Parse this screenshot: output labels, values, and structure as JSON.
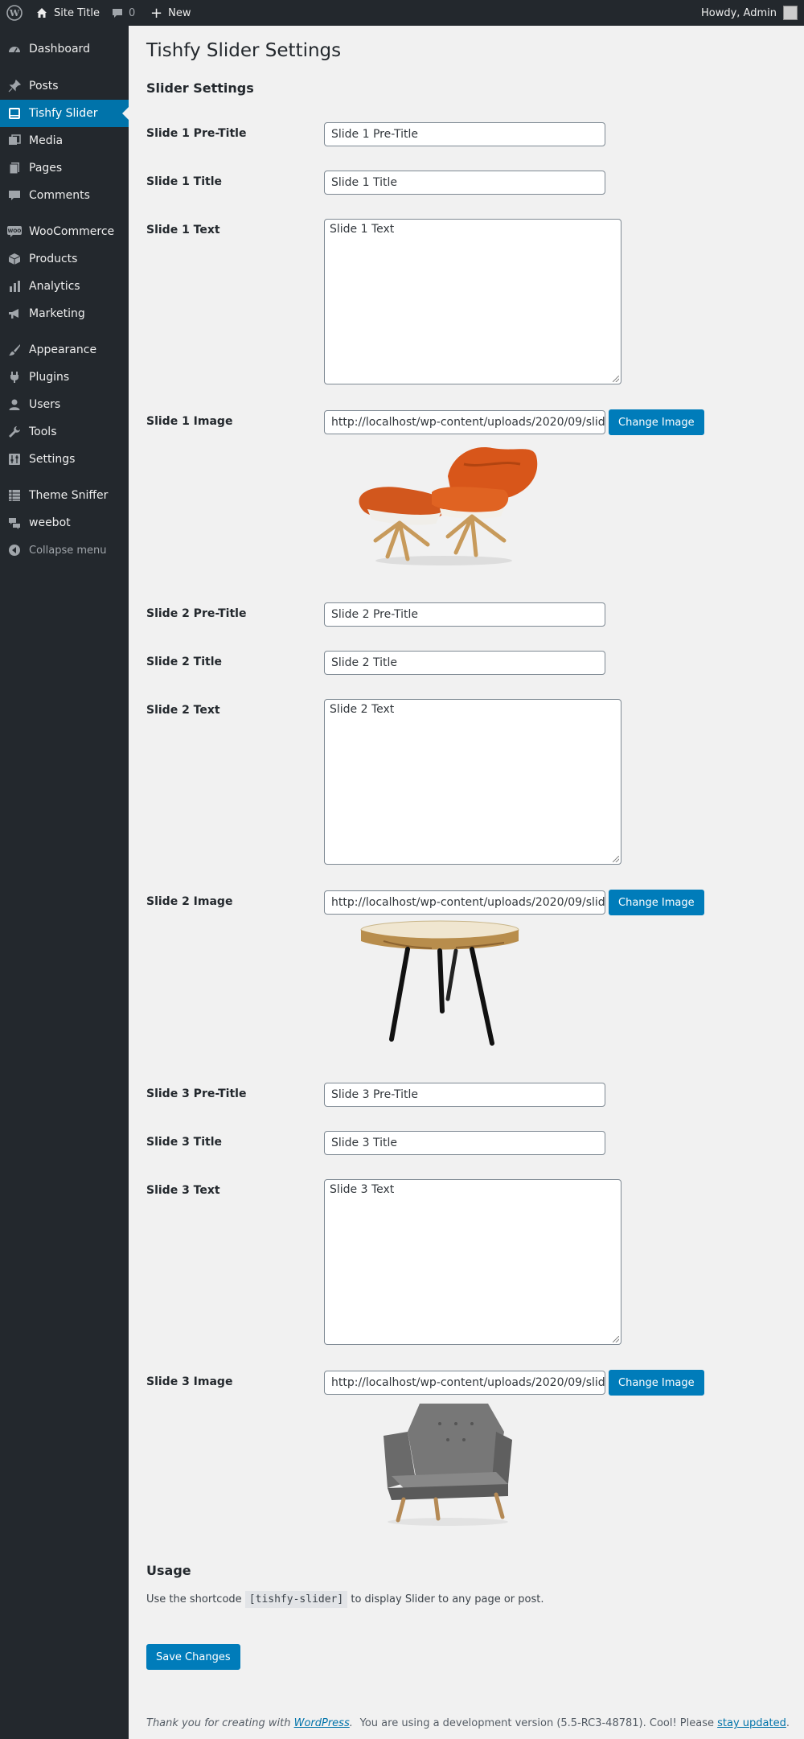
{
  "adminbar": {
    "site_title": "Site Title",
    "comment_count": "0",
    "new_label": "New",
    "howdy": "Howdy, Admin"
  },
  "sidebar": {
    "items": [
      {
        "label": "Dashboard",
        "icon": "dashboard-icon"
      },
      {
        "label": "Posts",
        "icon": "pin-icon"
      },
      {
        "label": "Tishfy Slider",
        "icon": "slider-icon"
      },
      {
        "label": "Media",
        "icon": "media-icon"
      },
      {
        "label": "Pages",
        "icon": "pages-icon"
      },
      {
        "label": "Comments",
        "icon": "comment-icon"
      },
      {
        "label": "WooCommerce",
        "icon": "woo-icon"
      },
      {
        "label": "Products",
        "icon": "box-icon"
      },
      {
        "label": "Analytics",
        "icon": "bar-chart-icon"
      },
      {
        "label": "Marketing",
        "icon": "megaphone-icon"
      },
      {
        "label": "Appearance",
        "icon": "paintbrush-icon"
      },
      {
        "label": "Plugins",
        "icon": "plug-icon"
      },
      {
        "label": "Users",
        "icon": "user-icon"
      },
      {
        "label": "Tools",
        "icon": "wrench-icon"
      },
      {
        "label": "Settings",
        "icon": "settings-icon"
      },
      {
        "label": "Theme Sniffer",
        "icon": "list-icon"
      },
      {
        "label": "weebot",
        "icon": "chat-icon"
      },
      {
        "label": "Collapse menu",
        "icon": "collapse-icon"
      }
    ],
    "current": "Tishfy Slider"
  },
  "page": {
    "title": "Tishfy Slider Settings",
    "section_title": "Slider Settings"
  },
  "slides": [
    {
      "pretitle_label": "Slide 1 Pre-Title",
      "pretitle_value": "Slide 1 Pre-Title",
      "title_label": "Slide 1 Title",
      "title_value": "Slide 1 Title",
      "text_label": "Slide 1 Text",
      "text_value": "Slide 1 Text",
      "image_label": "Slide 1 Image",
      "image_url": "http://localhost/wp-content/uploads/2020/09/slide1",
      "image_alt": "orange lounge chair and ottoman"
    },
    {
      "pretitle_label": "Slide 2 Pre-Title",
      "pretitle_value": "Slide 2 Pre-Title",
      "title_label": "Slide 2 Title",
      "title_value": "Slide 2 Title",
      "text_label": "Slide 2 Text",
      "text_value": "Slide 2 Text",
      "image_label": "Slide 2 Image",
      "image_url": "http://localhost/wp-content/uploads/2020/09/slide2",
      "image_alt": "wood slab side table with black legs"
    },
    {
      "pretitle_label": "Slide 3 Pre-Title",
      "pretitle_value": "Slide 3 Pre-Title",
      "title_label": "Slide 3 Title",
      "title_value": "Slide 3 Title",
      "text_label": "Slide 3 Text",
      "text_value": "Slide 3 Text",
      "image_label": "Slide 3 Image",
      "image_url": "http://localhost/wp-content/uploads/2020/09/slide3",
      "image_alt": "grey upholstered armchair"
    }
  ],
  "change_image_label": "Change Image",
  "usage": {
    "title": "Usage",
    "text_before": "Use the shortcode",
    "shortcode": "[tishfy-slider]",
    "text_after": "to display Slider to any page or post."
  },
  "save_label": "Save Changes",
  "footer": {
    "thanks_prefix": "Thank you for creating with",
    "wordpress_link": "WordPress",
    "thanks_suffix": ".",
    "version_text": "You are using a development version (5.5-RC3-48781). Cool! Please",
    "stay_updated_link": "stay updated",
    "version_suffix": "."
  },
  "colors": {
    "sidebar_bg": "#23282d",
    "accent": "#0073aa",
    "button": "#007cba",
    "page_bg": "#f1f1f1"
  }
}
